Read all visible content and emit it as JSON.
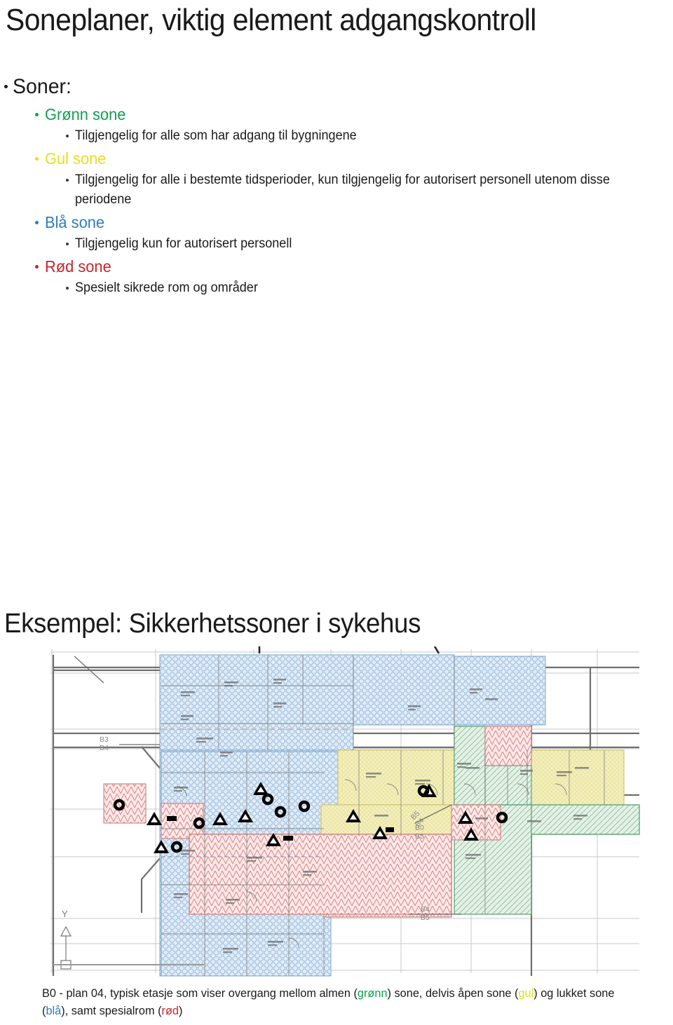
{
  "slide": {
    "title": "Soneplaner, viktig element adgangskontroll",
    "section_heading": "Eksempel: Sikkerhetssoner i sykehus"
  },
  "colors": {
    "green": "#12a04f",
    "yellow": "#e6e01c",
    "blue": "#2d7dbd",
    "red": "#c8252c",
    "text": "#1a1a1a"
  },
  "bullets": {
    "root_label": "Soner:",
    "zones": [
      {
        "name": "Grønn sone",
        "color": "#12a04f",
        "description": "Tilgjengelig for alle som har adgang til bygningene"
      },
      {
        "name": "Gul sone",
        "color": "#e6e01c",
        "description": "Tilgjengelig for alle i bestemte tidsperioder, kun tilgjengelig for autorisert personell utenom disse periodene"
      },
      {
        "name": "Blå sone",
        "color": "#2d7dbd",
        "description": "Tilgjengelig kun for autorisert personell"
      },
      {
        "name": "Rød sone",
        "color": "#c8252c",
        "description": "Spesielt sikrede rom og områder"
      }
    ]
  },
  "figure": {
    "caption_parts": [
      {
        "text": "B0 - plan 04, typisk etasje som viser overgang mellom almen (",
        "color": "#1a1a1a"
      },
      {
        "text": "grønn",
        "color": "#12a04f"
      },
      {
        "text": ") sone, delvis åpen sone (",
        "color": "#1a1a1a"
      },
      {
        "text": "gul",
        "color": "#e6e01c"
      },
      {
        "text": ") og lukket sone (",
        "color": "#1a1a1a"
      },
      {
        "text": "blå",
        "color": "#2d7dbd"
      },
      {
        "text": "), samt spesialrom (",
        "color": "#1a1a1a"
      },
      {
        "text": "rød",
        "color": "#c8252c"
      },
      {
        "text": ")",
        "color": "#1a1a1a"
      }
    ],
    "caption_full": "B0 - plan 04, typisk etasje som viser overgang mellom almen (grønn) sone, delvis åpen sone (gul) og lukket sone (blå), samt spesialrom (rød)",
    "plan_labels": [
      "B3",
      "B4",
      "B5",
      "B4",
      "B0",
      "B5",
      "B4",
      "B5",
      "Y"
    ],
    "zone_fills": {
      "blue_zone": "#dbe7f4",
      "yellow_zone": "#f3efb8",
      "red_zone": "#f6dada",
      "green_zone": "#dfeee2"
    }
  }
}
